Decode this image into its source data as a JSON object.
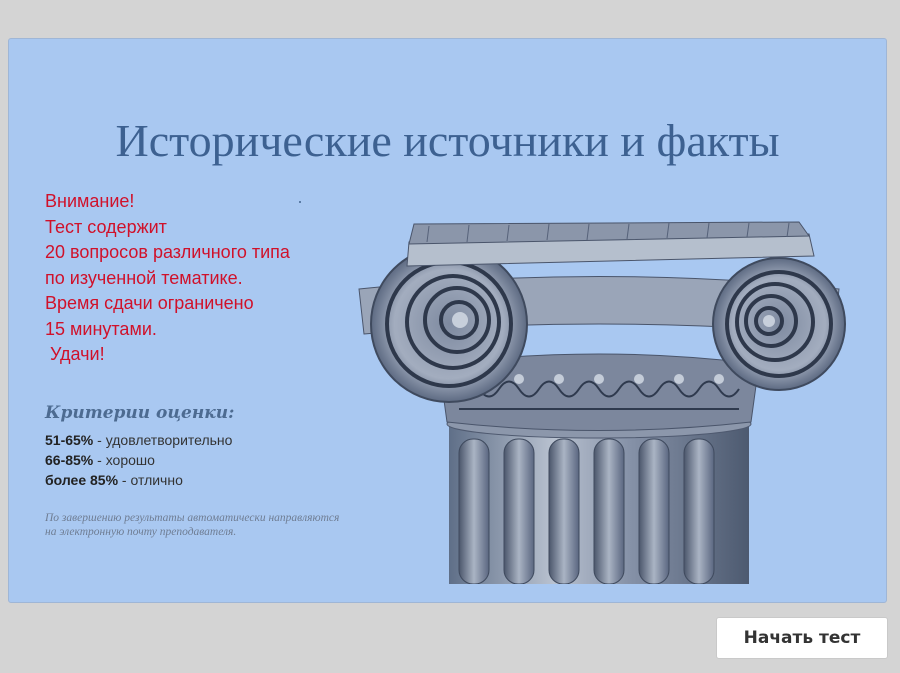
{
  "slide": {
    "title": "Исторические источники и факты",
    "warning_lines": [
      "Внимание!",
      "Тест содержит",
      "20 вопросов различного типа",
      "по изученной тематике.",
      "Время сдачи ограничено",
      "15 минутами.",
      " Удачи!"
    ],
    "criteria_title": "Критерии оценки:",
    "criteria": [
      {
        "range": "51-65%",
        "text": " - удовлетворительно"
      },
      {
        "range": "66-85%",
        "text": " - хорошо"
      },
      {
        "range": "более 85%",
        "text": " - отлично"
      }
    ],
    "footnote_lines": [
      "По завершению результаты автоматически направляются",
      "на электронную почту преподавателя."
    ]
  },
  "start_button": {
    "label": "Начать тест"
  },
  "colors": {
    "slide_bg": "#a9c8f1",
    "title": "#3d6191",
    "warning": "#d0112a",
    "page_bg": "#d4d4d4"
  }
}
